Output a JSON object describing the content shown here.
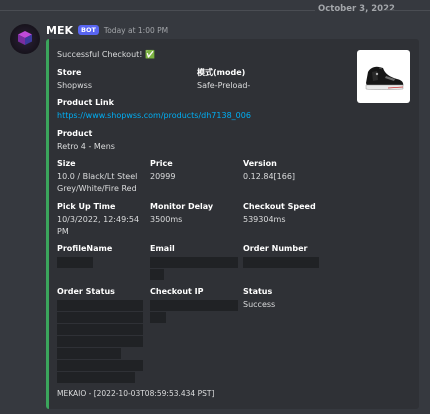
{
  "divider": {
    "date": "October 3, 2022"
  },
  "message": {
    "username": "MEK",
    "bot_tag": "BOT",
    "timestamp": "Today at 1:00 PM"
  },
  "embed": {
    "accent_color": "#3ba55c",
    "title": "Successful Checkout! ✅",
    "fields": {
      "store": {
        "name": "Store",
        "value": "Shopwss"
      },
      "mode": {
        "name": "模式(mode)",
        "value": "Safe-Preload-"
      },
      "product_link": {
        "name": "Product Link",
        "value": "https://www.shopwss.com/products/dh7138_006"
      },
      "product": {
        "name": "Product",
        "value": "Retro 4 - Mens"
      },
      "size": {
        "name": "Size",
        "value_line1": "10.0 / Black/Lt Steel",
        "value_line2": "Grey/White/Fire Red"
      },
      "price": {
        "name": "Price",
        "value": "20999"
      },
      "version": {
        "name": "Version",
        "value": "0.12.84[166]"
      },
      "pickup_time": {
        "name": "Pick Up Time",
        "value_line1": "10/3/2022, 12:49:54",
        "value_line2": "PM"
      },
      "monitor_delay": {
        "name": "Monitor Delay",
        "value": "3500ms"
      },
      "checkout_speed": {
        "name": "Checkout Speed",
        "value": "539304ms"
      },
      "profile_name": {
        "name": "ProfileName"
      },
      "email": {
        "name": "Email"
      },
      "order_number": {
        "name": "Order Number"
      },
      "order_status": {
        "name": "Order Status"
      },
      "checkout_ip": {
        "name": "Checkout IP"
      },
      "status": {
        "name": "Status",
        "value": "Success"
      }
    },
    "footer": "MEKAIO - [2022-10-03T08:59:53.434 PST]"
  }
}
